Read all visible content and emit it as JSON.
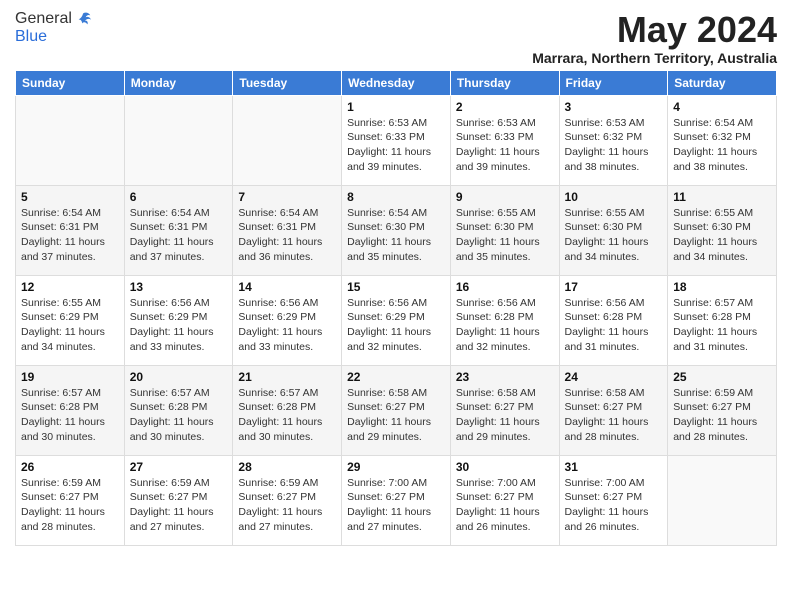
{
  "header": {
    "logo_general": "General",
    "logo_blue": "Blue",
    "month_title": "May 2024",
    "subtitle": "Marrara, Northern Territory, Australia"
  },
  "days_of_week": [
    "Sunday",
    "Monday",
    "Tuesday",
    "Wednesday",
    "Thursday",
    "Friday",
    "Saturday"
  ],
  "weeks": [
    [
      {
        "day": "",
        "info": ""
      },
      {
        "day": "",
        "info": ""
      },
      {
        "day": "",
        "info": ""
      },
      {
        "day": "1",
        "info": "Sunrise: 6:53 AM\nSunset: 6:33 PM\nDaylight: 11 hours and 39 minutes."
      },
      {
        "day": "2",
        "info": "Sunrise: 6:53 AM\nSunset: 6:33 PM\nDaylight: 11 hours and 39 minutes."
      },
      {
        "day": "3",
        "info": "Sunrise: 6:53 AM\nSunset: 6:32 PM\nDaylight: 11 hours and 38 minutes."
      },
      {
        "day": "4",
        "info": "Sunrise: 6:54 AM\nSunset: 6:32 PM\nDaylight: 11 hours and 38 minutes."
      }
    ],
    [
      {
        "day": "5",
        "info": "Sunrise: 6:54 AM\nSunset: 6:31 PM\nDaylight: 11 hours and 37 minutes."
      },
      {
        "day": "6",
        "info": "Sunrise: 6:54 AM\nSunset: 6:31 PM\nDaylight: 11 hours and 37 minutes."
      },
      {
        "day": "7",
        "info": "Sunrise: 6:54 AM\nSunset: 6:31 PM\nDaylight: 11 hours and 36 minutes."
      },
      {
        "day": "8",
        "info": "Sunrise: 6:54 AM\nSunset: 6:30 PM\nDaylight: 11 hours and 35 minutes."
      },
      {
        "day": "9",
        "info": "Sunrise: 6:55 AM\nSunset: 6:30 PM\nDaylight: 11 hours and 35 minutes."
      },
      {
        "day": "10",
        "info": "Sunrise: 6:55 AM\nSunset: 6:30 PM\nDaylight: 11 hours and 34 minutes."
      },
      {
        "day": "11",
        "info": "Sunrise: 6:55 AM\nSunset: 6:30 PM\nDaylight: 11 hours and 34 minutes."
      }
    ],
    [
      {
        "day": "12",
        "info": "Sunrise: 6:55 AM\nSunset: 6:29 PM\nDaylight: 11 hours and 34 minutes."
      },
      {
        "day": "13",
        "info": "Sunrise: 6:56 AM\nSunset: 6:29 PM\nDaylight: 11 hours and 33 minutes."
      },
      {
        "day": "14",
        "info": "Sunrise: 6:56 AM\nSunset: 6:29 PM\nDaylight: 11 hours and 33 minutes."
      },
      {
        "day": "15",
        "info": "Sunrise: 6:56 AM\nSunset: 6:29 PM\nDaylight: 11 hours and 32 minutes."
      },
      {
        "day": "16",
        "info": "Sunrise: 6:56 AM\nSunset: 6:28 PM\nDaylight: 11 hours and 32 minutes."
      },
      {
        "day": "17",
        "info": "Sunrise: 6:56 AM\nSunset: 6:28 PM\nDaylight: 11 hours and 31 minutes."
      },
      {
        "day": "18",
        "info": "Sunrise: 6:57 AM\nSunset: 6:28 PM\nDaylight: 11 hours and 31 minutes."
      }
    ],
    [
      {
        "day": "19",
        "info": "Sunrise: 6:57 AM\nSunset: 6:28 PM\nDaylight: 11 hours and 30 minutes."
      },
      {
        "day": "20",
        "info": "Sunrise: 6:57 AM\nSunset: 6:28 PM\nDaylight: 11 hours and 30 minutes."
      },
      {
        "day": "21",
        "info": "Sunrise: 6:57 AM\nSunset: 6:28 PM\nDaylight: 11 hours and 30 minutes."
      },
      {
        "day": "22",
        "info": "Sunrise: 6:58 AM\nSunset: 6:27 PM\nDaylight: 11 hours and 29 minutes."
      },
      {
        "day": "23",
        "info": "Sunrise: 6:58 AM\nSunset: 6:27 PM\nDaylight: 11 hours and 29 minutes."
      },
      {
        "day": "24",
        "info": "Sunrise: 6:58 AM\nSunset: 6:27 PM\nDaylight: 11 hours and 28 minutes."
      },
      {
        "day": "25",
        "info": "Sunrise: 6:59 AM\nSunset: 6:27 PM\nDaylight: 11 hours and 28 minutes."
      }
    ],
    [
      {
        "day": "26",
        "info": "Sunrise: 6:59 AM\nSunset: 6:27 PM\nDaylight: 11 hours and 28 minutes."
      },
      {
        "day": "27",
        "info": "Sunrise: 6:59 AM\nSunset: 6:27 PM\nDaylight: 11 hours and 27 minutes."
      },
      {
        "day": "28",
        "info": "Sunrise: 6:59 AM\nSunset: 6:27 PM\nDaylight: 11 hours and 27 minutes."
      },
      {
        "day": "29",
        "info": "Sunrise: 7:00 AM\nSunset: 6:27 PM\nDaylight: 11 hours and 27 minutes."
      },
      {
        "day": "30",
        "info": "Sunrise: 7:00 AM\nSunset: 6:27 PM\nDaylight: 11 hours and 26 minutes."
      },
      {
        "day": "31",
        "info": "Sunrise: 7:00 AM\nSunset: 6:27 PM\nDaylight: 11 hours and 26 minutes."
      },
      {
        "day": "",
        "info": ""
      }
    ]
  ]
}
